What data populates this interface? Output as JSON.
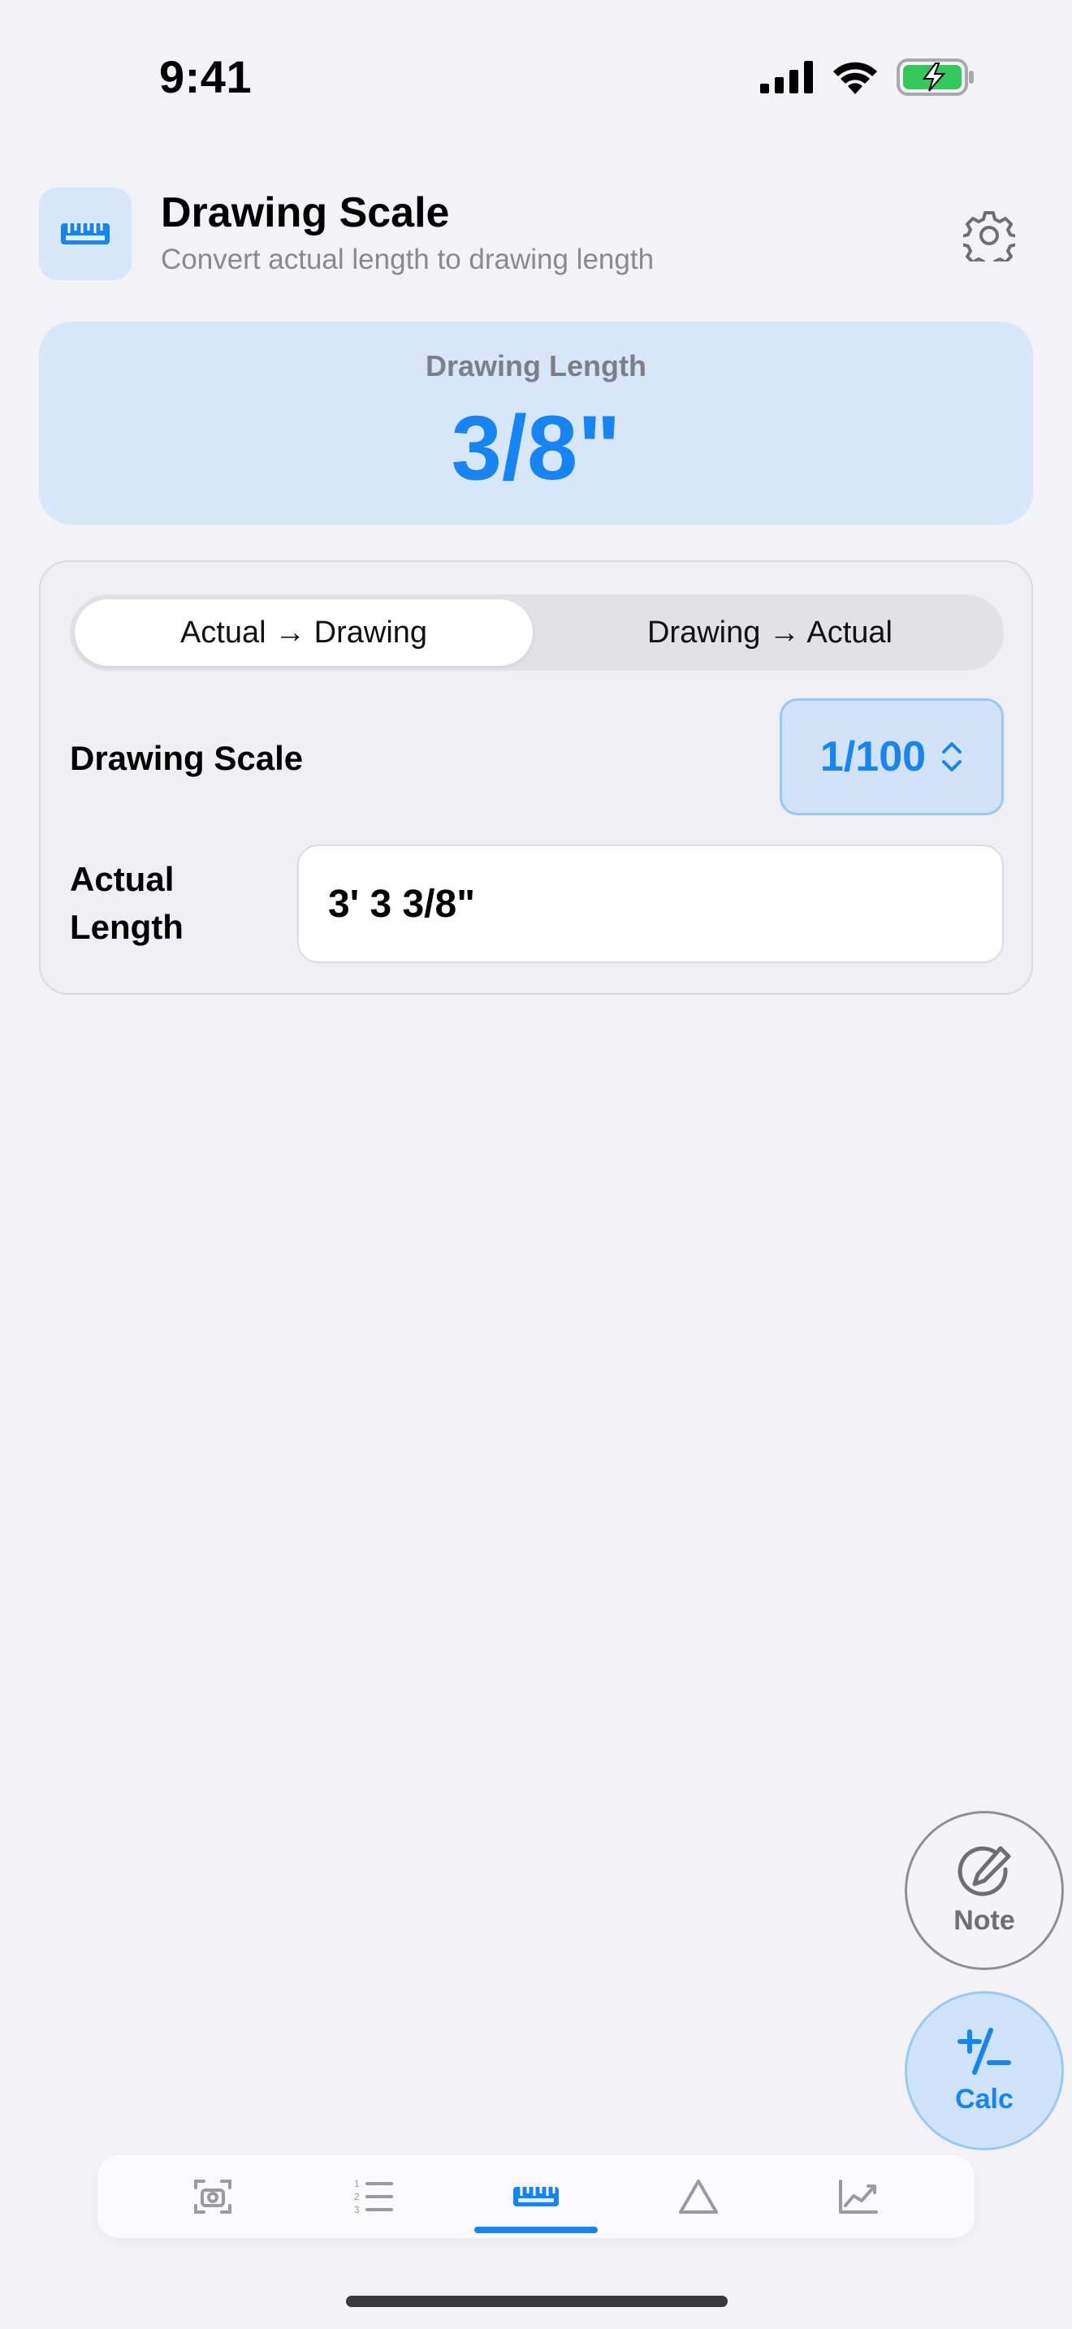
{
  "status_bar": {
    "time": "9:41"
  },
  "header": {
    "title": "Drawing Scale",
    "subtitle": "Convert actual length to drawing length",
    "icon": "ruler-icon"
  },
  "result": {
    "label": "Drawing Length",
    "value": "3/8\""
  },
  "converter": {
    "modes": [
      "Actual → Drawing",
      "Drawing → Actual"
    ],
    "selected_mode": "Actual → Drawing",
    "scale_label": "Drawing Scale",
    "scale_value": "1/100",
    "actual_label": "Actual Length",
    "actual_value": "3' 3 3/8\""
  },
  "fabs": {
    "note_label": "Note",
    "calc_label": "Calc"
  },
  "tabbar": {
    "items": [
      "camera-scan-icon",
      "numbered-list-icon",
      "ruler-icon",
      "triangle-icon",
      "chart-icon"
    ],
    "selected": "ruler-icon"
  },
  "colors": {
    "accent": "#1685f2",
    "background": "#f2f2f7",
    "result_card": "#d8e6fa"
  }
}
